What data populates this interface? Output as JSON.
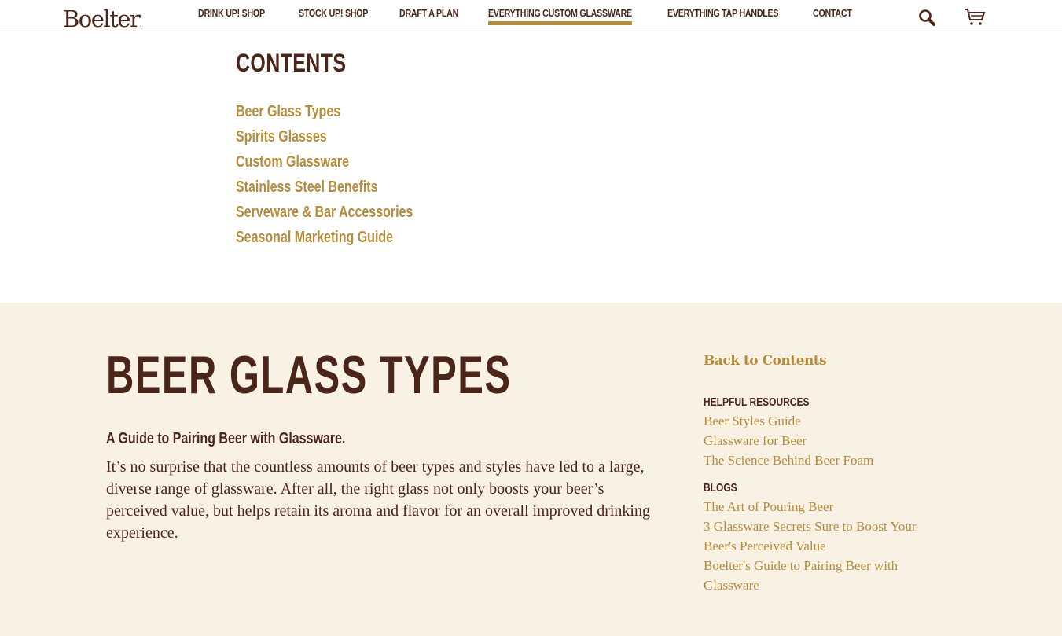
{
  "header": {
    "logo": "Boelter",
    "nav": [
      {
        "label": "DRINK UP! SHOP",
        "active": false
      },
      {
        "label": "STOCK UP! SHOP",
        "active": false
      },
      {
        "label": "DRAFT A PLAN",
        "active": false
      },
      {
        "label": "EVERYTHING CUSTOM GLASSWARE",
        "active": true
      },
      {
        "label": "EVERYTHING TAP HANDLES",
        "active": false
      },
      {
        "label": "CONTACT",
        "active": false
      }
    ],
    "icons": {
      "search": "search-icon",
      "cart": "cart-icon"
    }
  },
  "contents": {
    "title": "CONTENTS",
    "items": [
      "Beer Glass Types",
      "Spirits Glasses",
      "Custom Glassware",
      "Stainless Steel Benefits",
      "Serveware & Bar Accessories",
      "Seasonal Marketing Guide"
    ]
  },
  "section": {
    "title": "BEER GLASS TYPES",
    "subtitle": "A Guide to Pairing Beer with Glassware.",
    "body": "It’s no surprise that the countless amounts of beer types and styles have led to a large, diverse range of glassware. After all, the right glass not only boosts your beer’s perceived value, but helps retain its aroma and flavor for an overall improved drinking experience."
  },
  "aside": {
    "back_link": "Back to Contents",
    "resources_heading": "HELPFUL RESOURCES",
    "resources": [
      "Beer Styles Guide",
      "Glassware for Beer",
      "The Science Behind Beer Foam"
    ],
    "blogs_heading": "BLOGS",
    "blogs": [
      "The Art of Pouring Beer",
      "3 Glassware Secrets Sure to Boost Your Beer's Perceived Value",
      "Boelter's Guide to Pairing Beer with Glassware"
    ]
  },
  "colors": {
    "brown": "#4a2519",
    "gold": "#b48c3e",
    "cream": "#faf1e5"
  }
}
